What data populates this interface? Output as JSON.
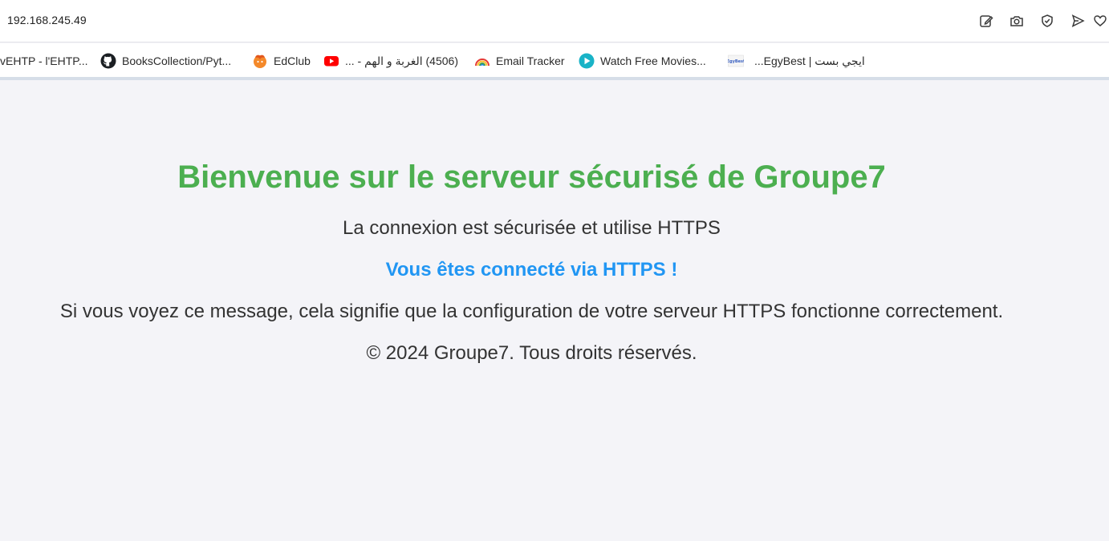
{
  "browser": {
    "url": "192.168.245.49",
    "address_icons": [
      "edit-icon",
      "camera-icon",
      "shield-check-icon",
      "send-icon",
      "heart-icon"
    ]
  },
  "bookmarks": [
    {
      "label": "vEHTP - l'EHTP...",
      "icon": "none"
    },
    {
      "label": "BooksCollection/Pyt...",
      "icon": "github-icon"
    },
    {
      "label": "EdClub",
      "icon": "edclub-icon"
    },
    {
      "label": "(4506) الغربة و الهم - ...",
      "icon": "youtube-icon"
    },
    {
      "label": "Email Tracker",
      "icon": "rainbow-icon"
    },
    {
      "label": "Watch Free Movies...",
      "icon": "play-icon"
    },
    {
      "label": "ايجي بست | EgyBest...",
      "icon": "egybest-icon"
    }
  ],
  "content": {
    "title": "Bienvenue sur le serveur sécurisé de Groupe7",
    "subtitle": "La connexion est sécurisée et utilise HTTPS",
    "https_notice": "Vous êtes connecté via HTTPS !",
    "message": "Si vous voyez ce message, cela signifie que la configuration de votre serveur HTTPS fonctionne correctement.",
    "footer": "© 2024 Groupe7. Tous droits réservés."
  },
  "colors": {
    "title": "#4caf50",
    "https_notice": "#2196f3",
    "body_text": "#333333",
    "page_background": "#f4f4f8"
  }
}
